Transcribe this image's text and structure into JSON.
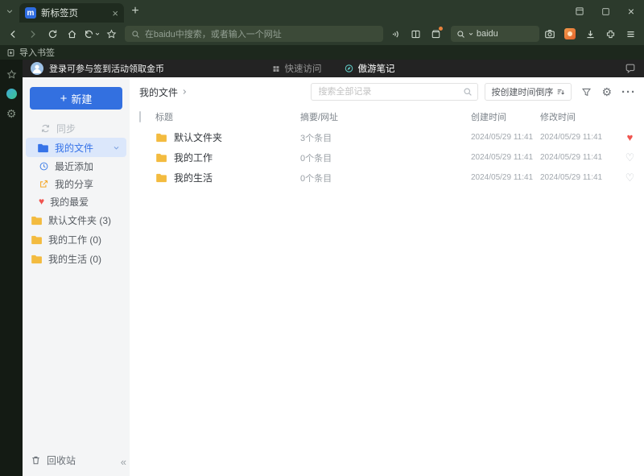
{
  "colors": {
    "chrome_green": "#2c3a2c",
    "chrome_green_dark": "#1f2b1f",
    "accent_blue": "#3370e0",
    "selected_blue_bg": "#dbe7fb",
    "folder_yellow": "#f3bb3f",
    "heart_red": "#f0544f"
  },
  "window": {
    "tab_title": "新标签页",
    "logo_letter": "m"
  },
  "toolbar": {
    "address_placeholder": "在baidu中搜索，或者输入一个网址",
    "quick_search_value": "baidu"
  },
  "bookmarks_bar": {
    "import_label": "导入书签"
  },
  "notes_header": {
    "login_text": "登录可参与签到活动领取金币",
    "tab_quick_access": "快速访问",
    "tab_notes": "傲游笔记"
  },
  "sidebar": {
    "new_button": "新建",
    "sync_label": "同步",
    "my_files_label": "我的文件",
    "sub_items": [
      {
        "label": "最近添加"
      },
      {
        "label": "我的分享"
      },
      {
        "label": "我的最爱"
      }
    ],
    "folders": [
      {
        "label": "默认文件夹 (3)"
      },
      {
        "label": "我的工作 (0)"
      },
      {
        "label": "我的生活 (0)"
      }
    ],
    "recycle_label": "回收站",
    "collapse_glyph": "«"
  },
  "main": {
    "breadcrumb": "我的文件",
    "search_placeholder": "搜索全部记录",
    "sort_label": "按创建时间倒序",
    "table": {
      "headers": {
        "title": "标题",
        "summary": "摘要/网址",
        "created": "创建时间",
        "modified": "修改时间"
      },
      "rows": [
        {
          "title": "默认文件夹",
          "summary": "3个条目",
          "created": "2024/05/29 11:41",
          "modified": "2024/05/29 11:41",
          "favorite": true
        },
        {
          "title": "我的工作",
          "summary": "0个条目",
          "created": "2024/05/29 11:41",
          "modified": "2024/05/29 11:41",
          "favorite": false
        },
        {
          "title": "我的生活",
          "summary": "0个条目",
          "created": "2024/05/29 11:41",
          "modified": "2024/05/29 11:41",
          "favorite": false
        }
      ]
    }
  }
}
